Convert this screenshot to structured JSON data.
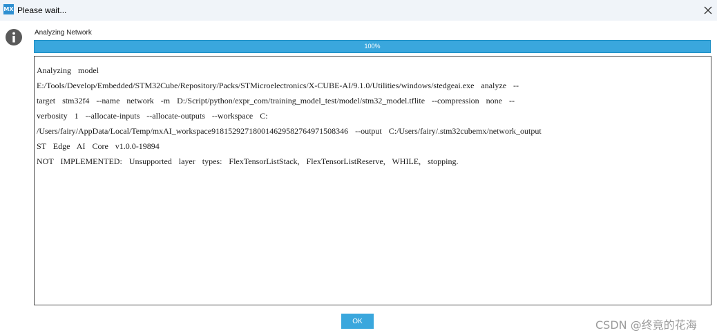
{
  "window": {
    "icon_text": "MX",
    "title": "Please wait...",
    "close_icon": "close-icon"
  },
  "status": {
    "icon": "info-icon",
    "label": "Analyzing Network"
  },
  "progress": {
    "percent": 100,
    "text": "100%"
  },
  "log": {
    "lines": [
      "Analyzing  model",
      "E:/Tools/Develop/Embedded/STM32Cube/Repository/Packs/STMicroelectronics/X-CUBE-AI/9.1.0/Utilities/windows/stedgeai.exe  analyze  --",
      "target  stm32f4  --name  network  -m  D:/Script/python/expr_com/training_model_test/model/stm32_model.tflite  --compression  none  --",
      "verbosity  1  --allocate-inputs  --allocate-outputs  --workspace  C:",
      "/Users/fairy/AppData/Local/Temp/mxAI_workspace918152927180014629582764971508346  --output  C:/Users/fairy/.stm32cubemx/network_output",
      "ST  Edge  AI  Core  v1.0.0-19894",
      "NOT  IMPLEMENTED:  Unsupported  layer  types:  FlexTensorListStack,  FlexTensorListReserve,  WHILE,  stopping."
    ]
  },
  "actions": {
    "ok_label": "OK"
  },
  "watermark": {
    "text": "CSDN @终竟的花海"
  },
  "colors": {
    "accent": "#3aa7dd",
    "titlebar": "#f0f4f9",
    "info_icon": "#5a5a5a"
  }
}
